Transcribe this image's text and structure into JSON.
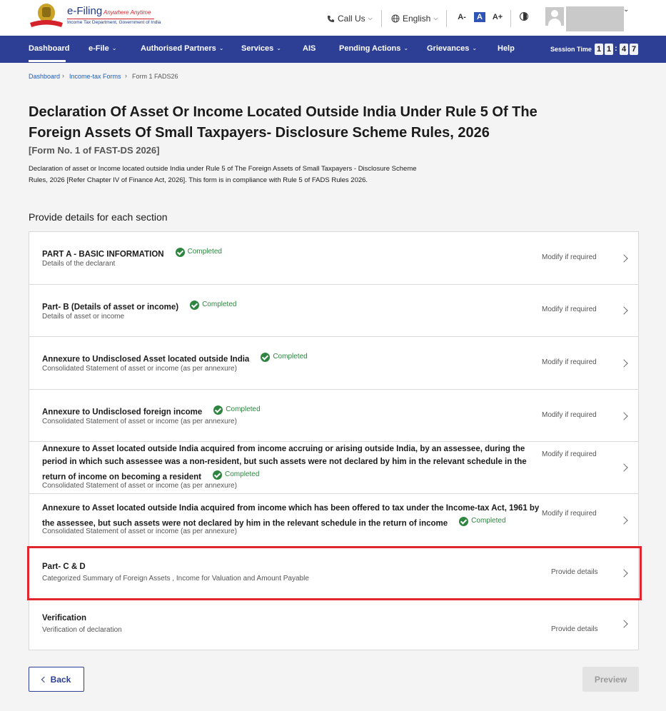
{
  "header": {
    "logo_title": "e-Filing",
    "logo_tagline": "Anywhere Anytime",
    "logo_subtitle": "Income Tax Department, Government of India",
    "call_us": "Call Us",
    "language": "English",
    "font_decrease": "A-",
    "font_normal": "A",
    "font_increase": "A+"
  },
  "nav": {
    "items": [
      {
        "label": "Dashboard"
      },
      {
        "label": "e-File"
      },
      {
        "label": "Authorised Partners"
      },
      {
        "label": "Services"
      },
      {
        "label": "AIS"
      },
      {
        "label": "Pending Actions"
      },
      {
        "label": "Grievances"
      },
      {
        "label": "Help"
      }
    ],
    "session_label": "Session Time",
    "session_digits": [
      "1",
      "1",
      "4",
      "7"
    ]
  },
  "breadcrumb": {
    "items": [
      "Dashboard",
      "Income-tax Forms",
      "Form 1 FADS26"
    ]
  },
  "page": {
    "title": "Declaration Of Asset Or Income Located Outside India Under Rule 5 Of The Foreign Assets Of Small Taxpayers- Disclosure Scheme Rules, 2026",
    "form_no": "[Form No. 1 of FAST-DS 2026]",
    "description": "Declaration of asset or Income located outside India under Rule 5 of The Foreign Assets of Small Taxpayers - Disclosure Scheme Rules, 2026 [Refer Chapter IV of Finance Act, 2026]. This form is in compliance with Rule 5 of FADS Rules 2026.",
    "section_heading": "Provide details for each section"
  },
  "sections": [
    {
      "title": "PART A - BASIC INFORMATION",
      "subtitle": "Details of the declarant",
      "status": "Completed",
      "action": "Modify if required"
    },
    {
      "title": "Part- B (Details of asset or income)",
      "subtitle": "Details of asset or income",
      "status": "Completed",
      "action": "Modify if required"
    },
    {
      "title": "Annexure to Undisclosed Asset located outside India",
      "subtitle": "Consolidated Statement of asset or income (as per annexure)",
      "status": "Completed",
      "action": "Modify if required"
    },
    {
      "title": "Annexure to Undisclosed foreign income",
      "subtitle": "Consolidated Statement of asset or income (as per annexure)",
      "status": "Completed",
      "action": "Modify if required"
    },
    {
      "title_lines": [
        "Annexure to Asset located outside India acquired from income accruing or arising outside India, by an assessee, during the",
        "period in which such assessee was a non-resident, but such assets were not declared by him in the relevant schedule in the",
        "return of income on becoming a resident"
      ],
      "subtitle": "Consolidated Statement of asset or income (as per annexure)",
      "status": "Completed",
      "action": "Modify if required"
    },
    {
      "title_lines": [
        "Annexure to Asset located outside India acquired from income which has been offered to tax under the Income-tax Act, 1961 by",
        "the assessee, but such assets were not declared by him in the relevant schedule in the return of income"
      ],
      "subtitle": "Consolidated Statement of asset or income (as per annexure)",
      "status": "Completed",
      "action": "Modify if required"
    },
    {
      "title": "Part- C & D",
      "subtitle": "Categorized Summary of Foreign Assets , Income for Valuation and Amount Payable",
      "action": "Provide details"
    },
    {
      "title": "Verification",
      "subtitle": "Verification of declaration",
      "action": "Provide details"
    }
  ],
  "footer": {
    "back_label": "Back",
    "preview_label": "Preview"
  },
  "colors": {
    "nav_bg": "#2d3f95",
    "completed_green": "#2e8540",
    "highlight_red": "#e0252e",
    "link_blue": "#1e5bb8"
  }
}
